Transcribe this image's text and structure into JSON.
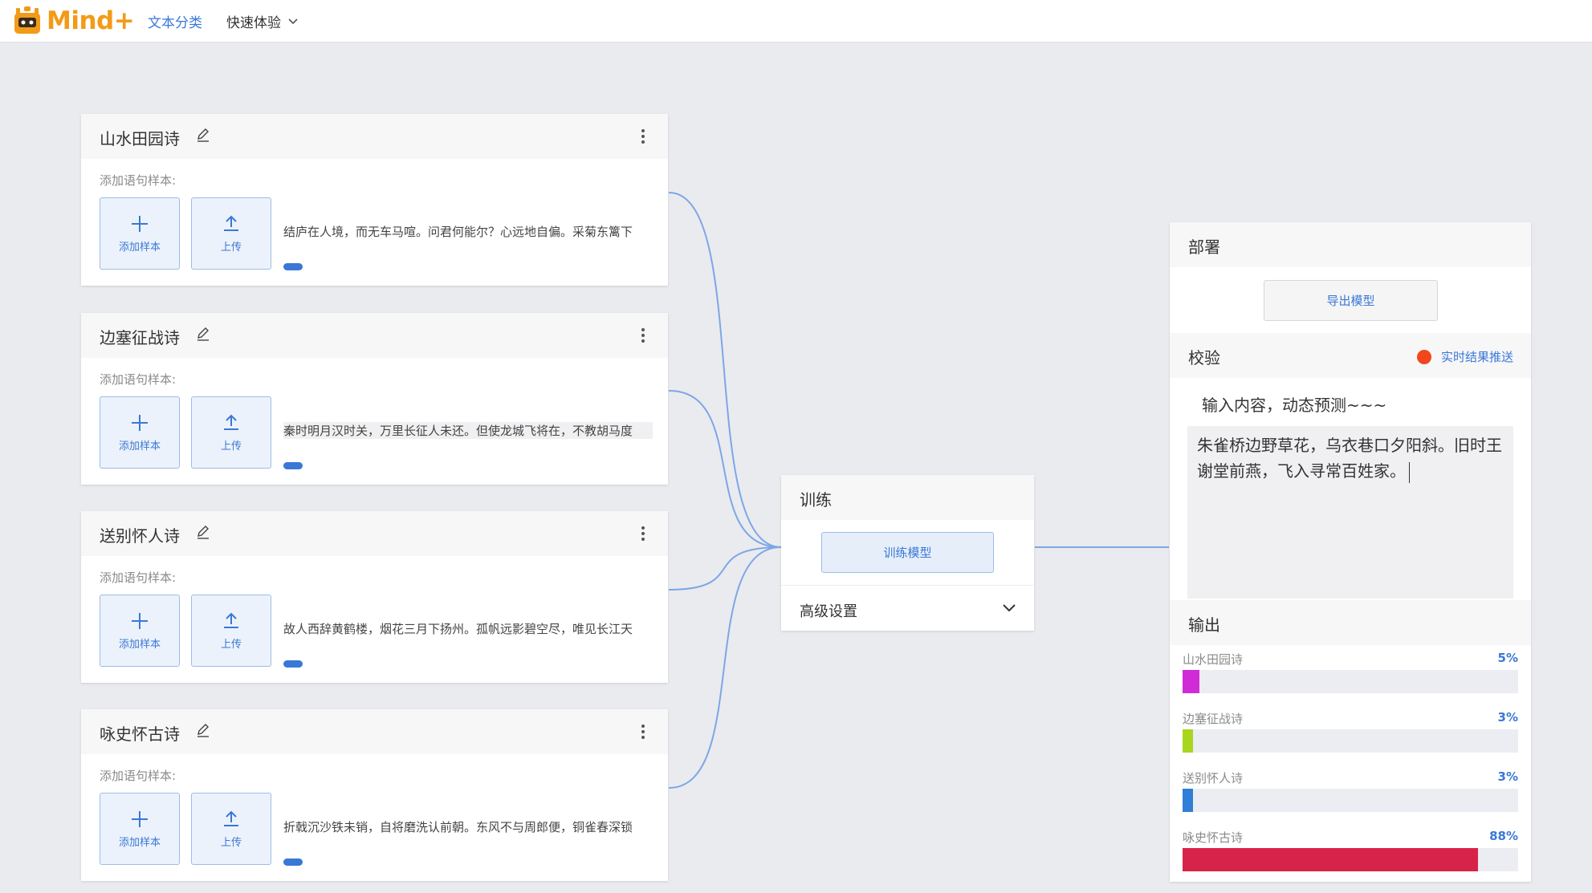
{
  "app": {
    "logo": "Mind+",
    "nav_title": "文本分类",
    "nav_menu": "快速体验"
  },
  "classes": [
    {
      "title": "山水田园诗",
      "label": "添加语句样本:",
      "add_label": "添加样本",
      "upload_label": "上传",
      "sample": "结庐在人境，而无车马喧。问君何能尔？心远地自偏。采菊东篱下"
    },
    {
      "title": "边塞征战诗",
      "label": "添加语句样本:",
      "add_label": "添加样本",
      "upload_label": "上传",
      "sample": "秦时明月汉时关，万里长征人未还。但使龙城飞将在，不教胡马度"
    },
    {
      "title": "送别怀人诗",
      "label": "添加语句样本:",
      "add_label": "添加样本",
      "upload_label": "上传",
      "sample": "故人西辞黄鹤楼，烟花三月下扬州。孤帆远影碧空尽，唯见长江天"
    },
    {
      "title": "咏史怀古诗",
      "label": "添加语句样本:",
      "add_label": "添加样本",
      "upload_label": "上传",
      "sample": "折戟沉沙铁未销，自将磨洗认前朝。东风不与周郎便，铜雀春深锁"
    }
  ],
  "train": {
    "title": "训练",
    "button": "训练模型",
    "advanced": "高级设置"
  },
  "deploy": {
    "title": "部署",
    "export": "导出模型"
  },
  "verify": {
    "title": "校验",
    "push_label": "实时结果推送",
    "prompt": "输入内容，动态预测~~~",
    "input_text": "朱雀桥边野草花，乌衣巷口夕阳斜。旧时王谢堂前燕，飞入寻常百姓家。"
  },
  "output": {
    "title": "输出",
    "items": [
      {
        "label": "山水田园诗",
        "pct_text": "5%",
        "value": 0.05,
        "color": "#d12bd8"
      },
      {
        "label": "边塞征战诗",
        "pct_text": "3%",
        "value": 0.03,
        "color": "#a7d61d"
      },
      {
        "label": "送别怀人诗",
        "pct_text": "3%",
        "value": 0.03,
        "color": "#2f7fd6"
      },
      {
        "label": "咏史怀古诗",
        "pct_text": "88%",
        "value": 0.88,
        "color": "#d7234a"
      }
    ]
  },
  "colors": {
    "accent": "#3a78d6",
    "brand": "#f29b18",
    "link_line": "#7da7e6",
    "push_dot": "#f2461d"
  }
}
